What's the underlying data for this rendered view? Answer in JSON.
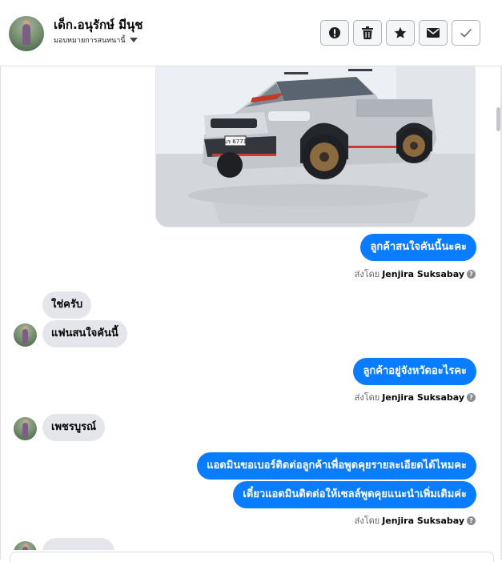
{
  "contact": {
    "name": "เด็ก.อนุรักษ์ มีนุช",
    "assign_label": "มอบหมายการสนทนานี้"
  },
  "toolbar": {
    "buttons": [
      {
        "icon": "alert-icon",
        "label": ""
      },
      {
        "icon": "trash-icon",
        "label": ""
      },
      {
        "icon": "star-icon",
        "label": ""
      },
      {
        "icon": "mail-icon",
        "label": ""
      },
      {
        "icon": "check-icon",
        "label": ""
      }
    ]
  },
  "messages": {
    "m1": "ลูกค้าสนใจคันนี้นะคะ",
    "m2": "ใช่ครับ",
    "m3": "แฟนสนใจคันนี้",
    "m4": "ลูกค้าอยู่จังหวัดอะไรคะ",
    "m5": "เพชรบูรณ์",
    "m6": "แอดมินขอเบอร์ติดต่อลูกค้าเพื่อพูดคุยรายละเอียดได้ไหมคะ",
    "m7": "เดี๋ยวแอดมินติดต่อให้เซลล์พูดคุยแนะนำเพิ่มเติมค่ะ"
  },
  "sent_by": {
    "prefix": "ส่งโดย",
    "name": "Jenjira Suksabay",
    "help": "?"
  },
  "car_plate": "บร 6771",
  "colors": {
    "accent": "#0a7cff",
    "incoming_bubble": "#e4e6eb"
  }
}
